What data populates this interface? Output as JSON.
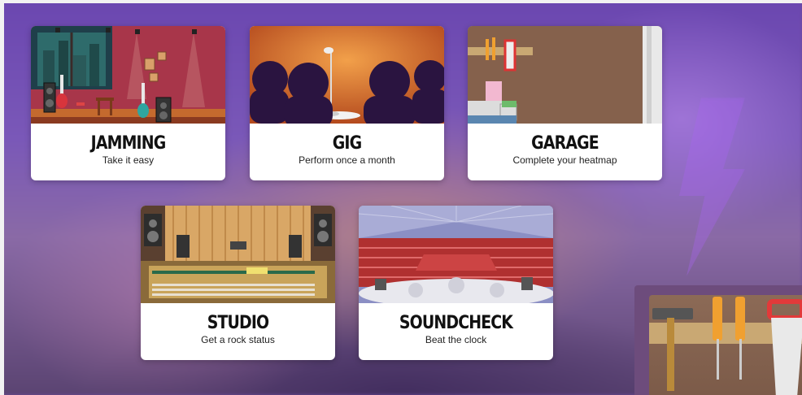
{
  "cards": [
    {
      "id": "jamming",
      "title": "JAMMING",
      "subtitle": "Take it easy"
    },
    {
      "id": "gig",
      "title": "GIG",
      "subtitle": "Perform once a month"
    },
    {
      "id": "garage",
      "title": "GARAGE",
      "subtitle": "Complete your heatmap"
    },
    {
      "id": "studio",
      "title": "STUDIO",
      "subtitle": "Get a rock status"
    },
    {
      "id": "soundcheck",
      "title": "SOUNDCHECK",
      "subtitle": "Beat the clock"
    }
  ],
  "colors": {
    "background": "#6a4a9a",
    "card": "#ffffff",
    "title": "#111111"
  }
}
